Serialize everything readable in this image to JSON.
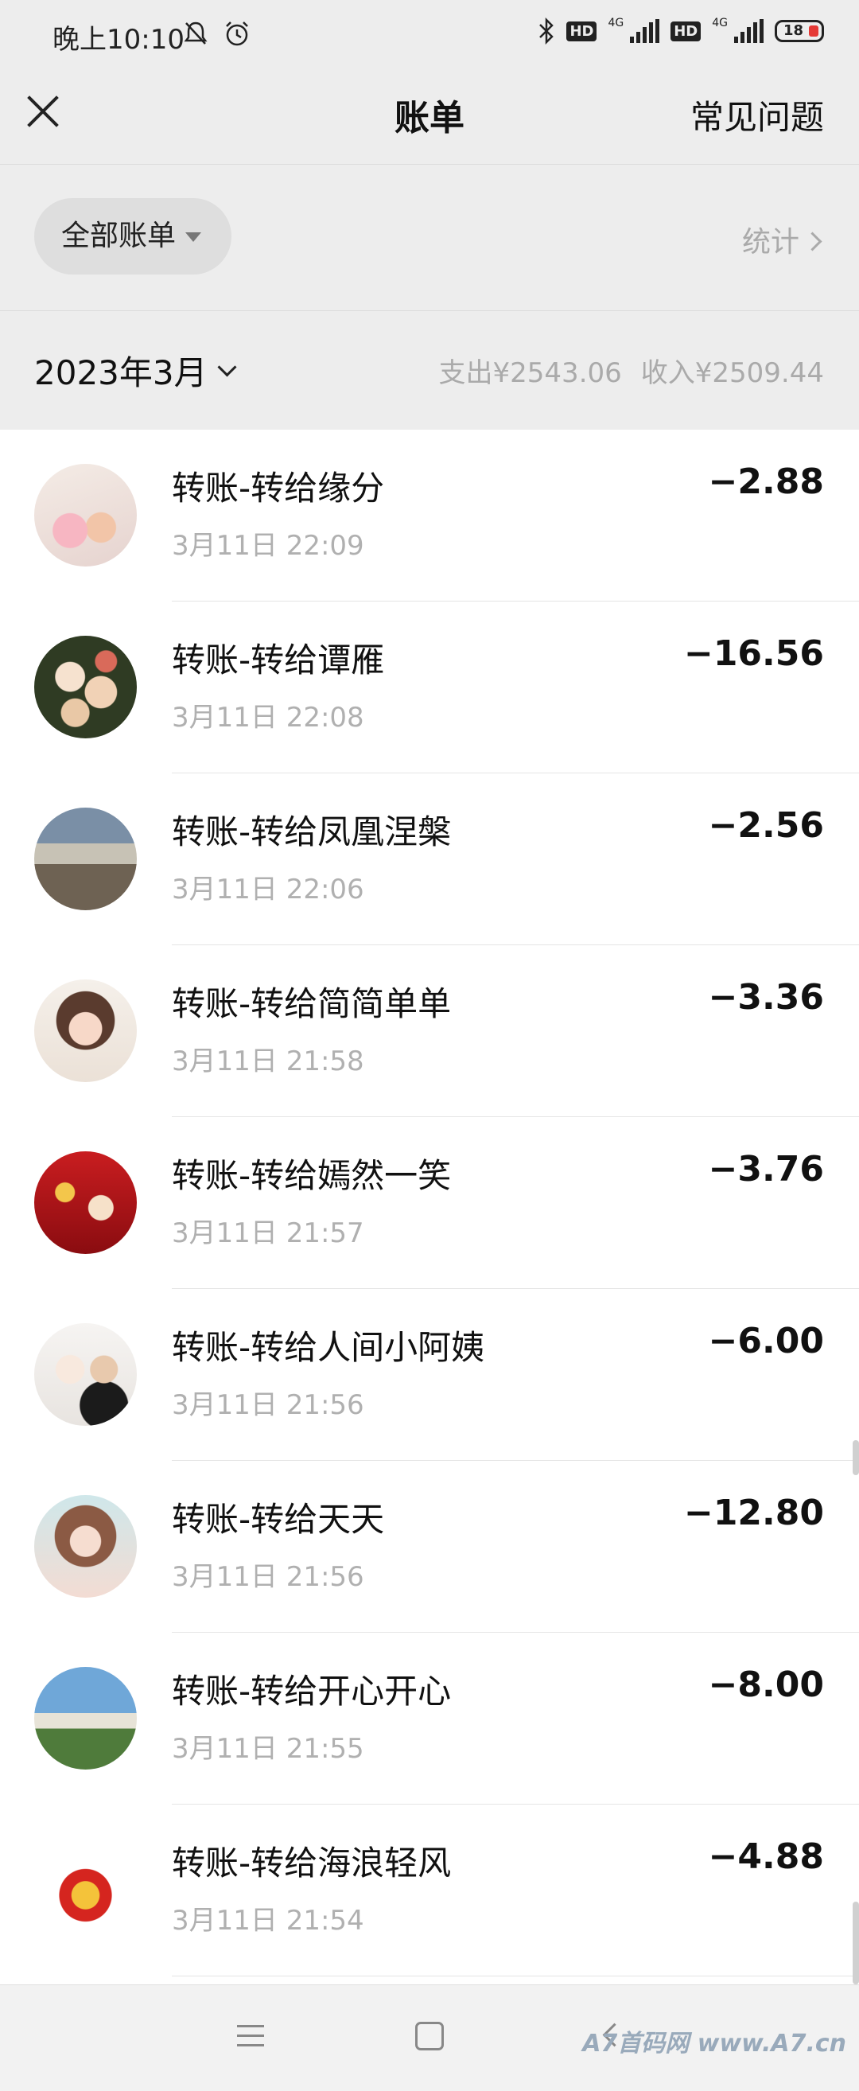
{
  "status_bar": {
    "time": "晚上10:10",
    "icons": [
      "mute-bell-icon",
      "alarm-icon",
      "bluetooth-icon",
      "hd-icon",
      "signal-4g-icon",
      "hd-icon",
      "signal-4g-icon"
    ],
    "hd": "HD",
    "net": "4G",
    "battery": "18",
    "battery_color": "#e53935"
  },
  "nav": {
    "title": "账单",
    "faq": "常见问题"
  },
  "filter": {
    "label": "全部账单",
    "stats": "统计"
  },
  "month": {
    "label": "2023年3月",
    "expense": "支出¥2543.06",
    "income": "收入¥2509.44"
  },
  "transactions": [
    {
      "title": "转账-转给缘分",
      "time": "3月11日 22:09",
      "amount": "−2.88"
    },
    {
      "title": "转账-转给谭雁",
      "time": "3月11日 22:08",
      "amount": "−16.56"
    },
    {
      "title": "转账-转给凤凰涅槃",
      "time": "3月11日 22:06",
      "amount": "−2.56"
    },
    {
      "title": "转账-转给简简单单",
      "time": "3月11日 21:58",
      "amount": "−3.36"
    },
    {
      "title": "转账-转给嫣然一笑",
      "time": "3月11日 21:57",
      "amount": "−3.76"
    },
    {
      "title": "转账-转给人间小阿姨",
      "time": "3月11日 21:56",
      "amount": "−6.00"
    },
    {
      "title": "转账-转给天天",
      "time": "3月11日 21:56",
      "amount": "−12.80"
    },
    {
      "title": "转账-转给开心开心",
      "time": "3月11日 21:55",
      "amount": "−8.00"
    },
    {
      "title": "转账-转给海浪轻风",
      "time": "3月11日 21:54",
      "amount": "−4.88"
    }
  ],
  "bottom_nav": {
    "watermark": "A7首码网  www.A7.cn"
  }
}
